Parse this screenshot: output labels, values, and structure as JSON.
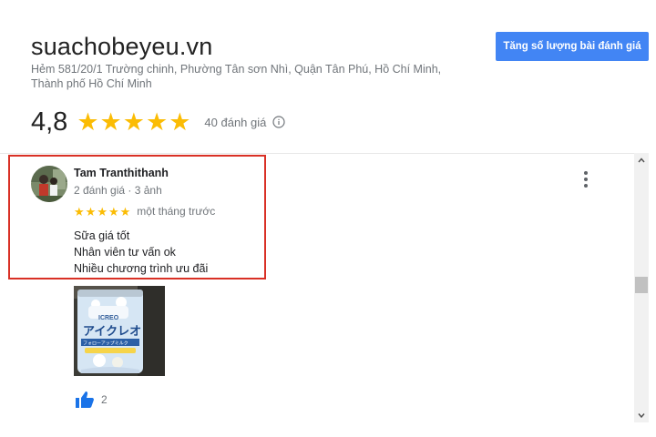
{
  "business": {
    "name": "suachobeyeu.vn",
    "address_line1": "Hẻm 581/20/1 Trường chinh, Phường Tân sơn Nhì, Quận Tân Phú, Hồ Chí Minh,",
    "address_line2": "Thành phố Hồ Chí Minh"
  },
  "cta": {
    "label": "Tăng số lượng bài đánh giá"
  },
  "rating": {
    "value": "4,8",
    "stars": 5,
    "review_count": "40 đánh giá"
  },
  "review": {
    "reviewer_name": "Tam Tranthithanh",
    "reviewer_meta": "2 đánh giá · 3 ảnh",
    "stars": 5,
    "time": "một tháng trước",
    "text_lines": [
      "Sữa giá tốt",
      "Nhân viên tư vấn ok",
      "Nhiều chương trình ưu đãi"
    ],
    "photo": {
      "brand": "ICREO",
      "product_text": "アイクレオ",
      "subtitle_text": "フォローアップミルク"
    },
    "likes": "2"
  },
  "colors": {
    "star": "#fbbc04",
    "cta_bg": "#4285f4",
    "highlight_border": "#d93025",
    "like_icon": "#1a73e8"
  },
  "icons": {
    "info": "info-icon",
    "more": "more-vert-icon",
    "like": "thumbs-up-icon",
    "scroll_up": "chevron-up-icon",
    "scroll_down": "chevron-down-icon"
  }
}
